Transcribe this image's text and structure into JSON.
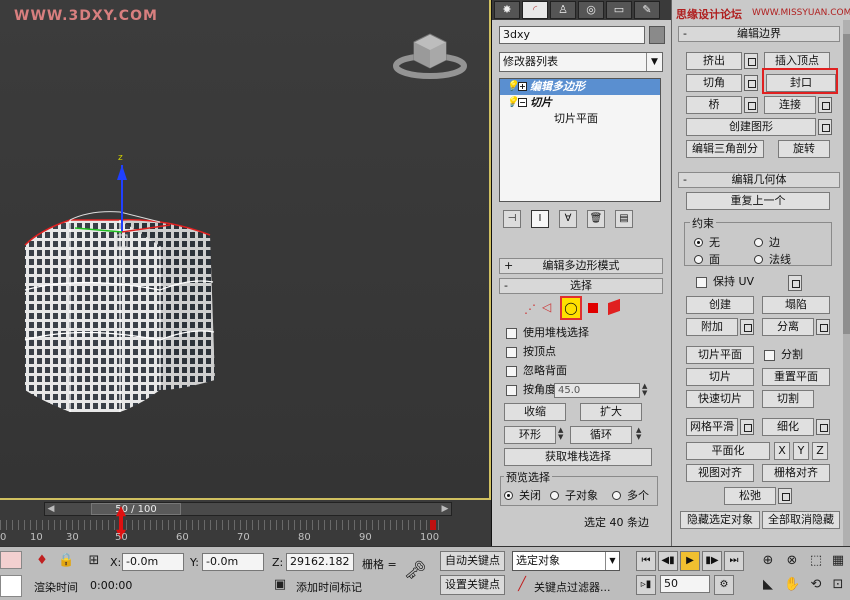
{
  "watermark": "WWW.3DXY.COM",
  "site_watermark": {
    "cn": "思缘设计论坛",
    "en": "WWW.MISSYUAN.COM"
  },
  "viewport": {
    "axis_z": "z"
  },
  "timeline": {
    "frame_display": "50 / 100",
    "ticks": [
      "0",
      "10",
      "20",
      "30",
      "40",
      "50",
      "60",
      "70",
      "80",
      "90",
      "100"
    ]
  },
  "command_panel": {
    "tab_icons": [
      "create-icon",
      "modify-icon",
      "hierarchy-icon",
      "motion-icon",
      "display-icon",
      "utilities-icon"
    ],
    "object_name": "3dxy",
    "modifier_list": "修改器列表",
    "stack": [
      {
        "label": "编辑多边形",
        "selected": true
      },
      {
        "label": "切片",
        "selected": false
      },
      {
        "label": "切片平面",
        "selected": false
      }
    ],
    "rollouts": {
      "edit_poly_mode": "编辑多边形模式",
      "selection": "选择"
    },
    "selection_options": {
      "use_stack": "使用堆栈选择",
      "by_vertex": "按顶点",
      "ignore_backface": "忽略背面",
      "by_angle": "按角度:",
      "angle_value": "45.0"
    },
    "buttons": {
      "shrink": "收缩",
      "grow": "扩大",
      "ring": "环形",
      "loop": "循环",
      "get_stack": "获取堆栈选择"
    },
    "preview": {
      "title": "预览选择",
      "off": "关闭",
      "subobject": "子对象",
      "multi": "多个"
    },
    "status": "选定 40 条边"
  },
  "right_panel": {
    "edit_borders": "编辑边界",
    "extrude": "挤出",
    "insert_vertex": "插入顶点",
    "chamfer": "切角",
    "cap": "封口",
    "bridge": "桥",
    "connect": "连接",
    "create_shape": "创建图形",
    "edit_tri": "编辑三角剖分",
    "rotate": "旋转",
    "edit_geometry": "编辑几何体",
    "repeat_last": "重复上一个",
    "constraints": "约束",
    "c_none": "无",
    "c_edge": "边",
    "c_face": "面",
    "c_normal": "法线",
    "preserve_uv": "保持 UV",
    "create": "创建",
    "collapse": "塌陷",
    "attach": "附加",
    "detach": "分离",
    "slice_plane": "切片平面",
    "split": "分割",
    "slice": "切片",
    "reset_plane": "重置平面",
    "quickslice": "快速切片",
    "cut": "切割",
    "meshsmooth": "网格平滑",
    "tessellate": "细化",
    "make_planar": "平面化",
    "x": "X",
    "y": "Y",
    "z": "Z",
    "view_align": "视图对齐",
    "grid_align": "栅格对齐",
    "relax": "松弛",
    "hide_sel": "隐藏选定对象",
    "unhide_all": "全部取消隐藏"
  },
  "bottom_bar": {
    "x_label": "X:",
    "x_value": "-0.0m",
    "y_label": "Y:",
    "y_value": "-0.0m",
    "z_label": "Z:",
    "z_value": "29162.182",
    "grid_label": "栅格 =",
    "render_time_label": "渲染时间",
    "render_time_value": "0:00:00",
    "add_time_tag": "添加时间标记",
    "auto_key": "自动关键点",
    "set_key": "设置关键点",
    "selected_object": "选定对象",
    "key_filters": "关键点过滤器...",
    "frame": "50"
  }
}
